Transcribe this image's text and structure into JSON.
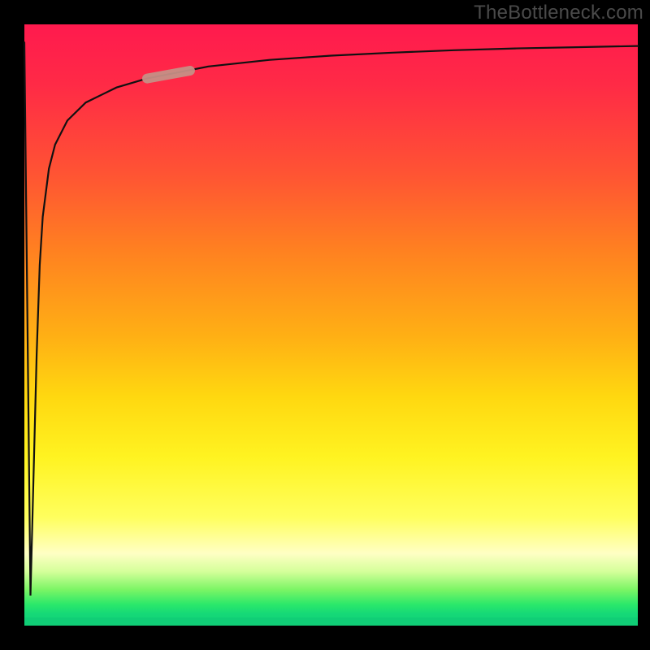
{
  "watermark": "TheBottleneck.com",
  "colors": {
    "gradient_top": "#ff1a4e",
    "gradient_mid": "#fff321",
    "gradient_bottom": "#10ce76",
    "curve": "#111111",
    "marker": "#c68f86",
    "frame": "#000000"
  },
  "chart_data": {
    "type": "line",
    "title": "",
    "xlabel": "",
    "ylabel": "",
    "xlim": [
      0,
      100
    ],
    "ylim": [
      0,
      100
    ],
    "grid": false,
    "legend": false,
    "series": [
      {
        "name": "bottleneck-curve",
        "x": [
          0,
          1,
          2,
          2.5,
          3,
          4,
          5,
          7,
          10,
          15,
          20,
          25,
          30,
          40,
          50,
          60,
          70,
          80,
          90,
          100
        ],
        "y": [
          97,
          5,
          45,
          60,
          68,
          76,
          80,
          84,
          87,
          89.5,
          91,
          92,
          93,
          94.1,
          94.8,
          95.3,
          95.7,
          96.0,
          96.2,
          96.4
        ]
      }
    ],
    "marker": {
      "note": "highlighted point along the curve",
      "x_start": 20,
      "y_start": 91,
      "x_end": 27,
      "y_end": 92.3
    }
  }
}
